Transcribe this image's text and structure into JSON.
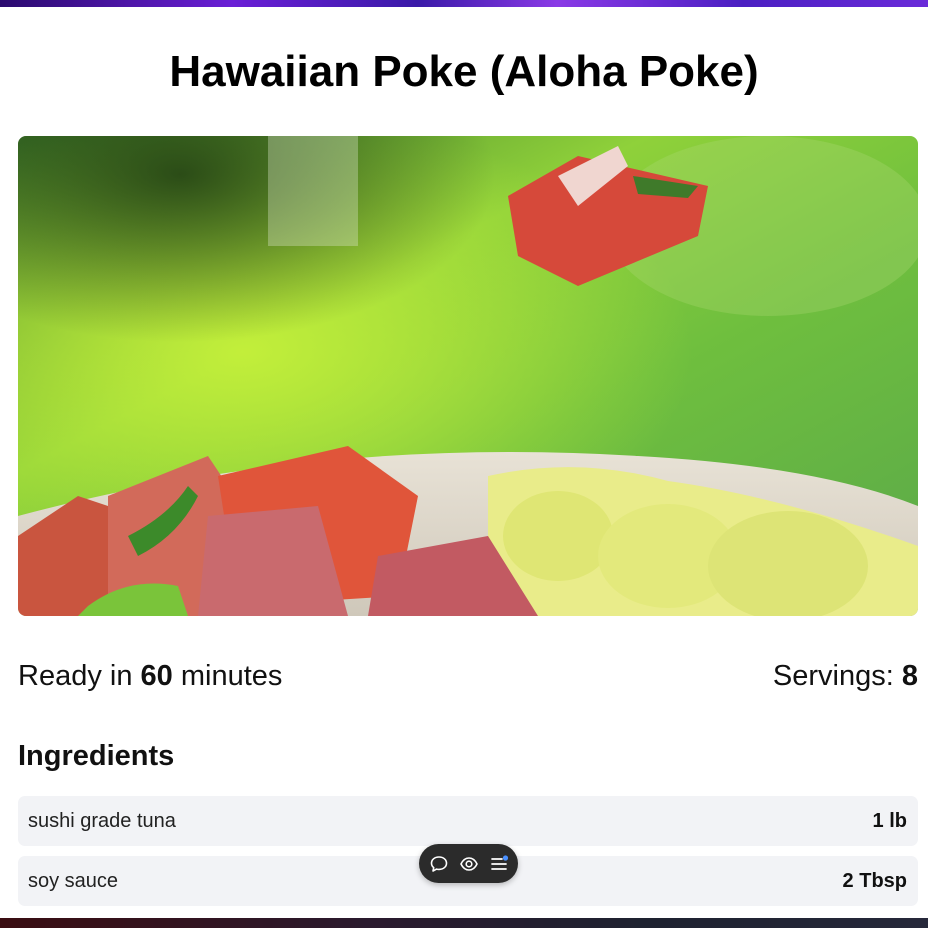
{
  "recipe": {
    "title": "Hawaiian Poke (Aloha Poke)",
    "ready_prefix": "Ready in ",
    "ready_minutes": "60",
    "ready_suffix": " minutes",
    "servings_label": "Servings: ",
    "servings_value": "8",
    "ingredients_heading": "Ingredients",
    "ingredients": [
      {
        "name": "sushi grade tuna",
        "qty": "1 lb"
      },
      {
        "name": "soy sauce",
        "qty": "2 Tbsp"
      }
    ]
  },
  "toolbar": {
    "icons": [
      "comment-icon",
      "eye-icon",
      "menu-list-icon"
    ],
    "accent": "#4a90ff",
    "background": "#2b2b2b"
  },
  "colors": {
    "top_strip": "#6a1fd6",
    "row_background": "#f2f3f6"
  }
}
